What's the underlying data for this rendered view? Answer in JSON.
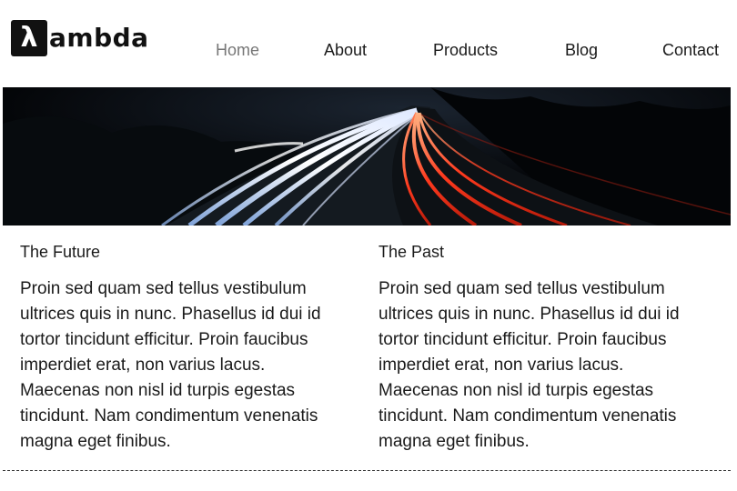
{
  "header": {
    "logo": {
      "mark": "λ",
      "text": "ambda"
    },
    "nav": [
      {
        "label": "Home",
        "active": true
      },
      {
        "label": "About",
        "active": false
      },
      {
        "label": "Products",
        "active": false
      },
      {
        "label": "Blog",
        "active": false
      },
      {
        "label": "Contact",
        "active": false
      }
    ]
  },
  "columns": [
    {
      "title": "The Future",
      "body": "Proin sed quam sed tellus vestibulum ultrices quis in nunc. Phasellus id dui id tortor tincidunt efficitur. Proin faucibus imperdiet erat, non varius lacus. Maecenas non nisl id turpis egestas tincidunt. Nam condimentum venenatis magna eget finibus."
    },
    {
      "title": "The Past",
      "body": "Proin sed quam sed tellus vestibulum ultrices quis in nunc. Phasellus id dui id tortor tincidunt efficitur. Proin faucibus imperdiet erat, non varius lacus. Maecenas non nisl id turpis egestas tincidunt. Nam condimentum venenatis magna eget finibus."
    }
  ],
  "colors": {
    "active_nav": "#777777",
    "text": "#1a1a1a",
    "hero_background": "#05070a",
    "light_trail_white": "#e8f0ff",
    "light_trail_red": "#ff4a2a"
  }
}
